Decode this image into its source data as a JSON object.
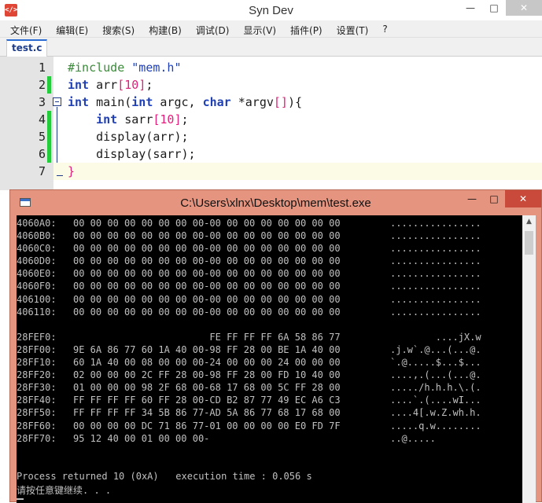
{
  "window": {
    "title": "Syn Dev",
    "minimize": "—",
    "maximize": "□",
    "close": "✕"
  },
  "menu": [
    "文件(F)",
    "编辑(E)",
    "搜索(S)",
    "构建(B)",
    "调试(D)",
    "显示(V)",
    "插件(P)",
    "设置(T)",
    "?"
  ],
  "tab": {
    "label": "test.c"
  },
  "editor": {
    "line_numbers": [
      "1",
      "2",
      "3",
      "4",
      "5",
      "6",
      "7"
    ],
    "line1": {
      "pre": "#include ",
      "str": "\"mem.h\""
    },
    "line2": {
      "kw": "int",
      "t1": " arr",
      "b1": "[",
      "n1": "10",
      "b2": "]",
      "t2": ";"
    },
    "line3": {
      "kw1": "int",
      "t1": " main(",
      "kw2": "int",
      "t2": " argc, ",
      "kw3": "char",
      "t3": " *argv",
      "b1": "[]",
      "t4": "){"
    },
    "line4": {
      "indent": "    ",
      "kw": "int",
      "t1": " sarr",
      "b1": "[",
      "n1": "10",
      "b2": "]",
      "t2": ";"
    },
    "line5": {
      "code": "    display(arr);"
    },
    "line6": {
      "code": "    display(sarr);"
    },
    "line7": {
      "code": "}"
    }
  },
  "console": {
    "title": "C:\\Users\\xlnx\\Desktop\\mem\\test.exe",
    "minimize": "—",
    "maximize": "□",
    "close": "✕",
    "block1": [
      {
        "addr": "4060A0:",
        "hex": "00 00 00 00 00 00 00 00-00 00 00 00 00 00 00 00",
        "ascii": "................"
      },
      {
        "addr": "4060B0:",
        "hex": "00 00 00 00 00 00 00 00-00 00 00 00 00 00 00 00",
        "ascii": "................"
      },
      {
        "addr": "4060C0:",
        "hex": "00 00 00 00 00 00 00 00-00 00 00 00 00 00 00 00",
        "ascii": "................"
      },
      {
        "addr": "4060D0:",
        "hex": "00 00 00 00 00 00 00 00-00 00 00 00 00 00 00 00",
        "ascii": "................"
      },
      {
        "addr": "4060E0:",
        "hex": "00 00 00 00 00 00 00 00-00 00 00 00 00 00 00 00",
        "ascii": "................"
      },
      {
        "addr": "4060F0:",
        "hex": "00 00 00 00 00 00 00 00-00 00 00 00 00 00 00 00",
        "ascii": "................"
      },
      {
        "addr": "406100:",
        "hex": "00 00 00 00 00 00 00 00-00 00 00 00 00 00 00 00",
        "ascii": "................"
      },
      {
        "addr": "406110:",
        "hex": "00 00 00 00 00 00 00 00-00 00 00 00 00 00 00 00",
        "ascii": "................"
      }
    ],
    "block2": [
      {
        "addr": "28FEF0:",
        "hex": "                        FE FF FF FF 6A 58 86 77",
        "ascii": "        ....jX.w"
      },
      {
        "addr": "28FF00:",
        "hex": "9E 6A 86 77 60 1A 40 00-98 FF 28 00 BE 1A 40 00",
        "ascii": ".j.w`.@...(...@."
      },
      {
        "addr": "28FF10:",
        "hex": "60 1A 40 00 08 00 00 00-24 00 00 00 24 00 00 00",
        "ascii": "`.@.....$...$..."
      },
      {
        "addr": "28FF20:",
        "hex": "02 00 00 00 2C FF 28 00-98 FF 28 00 FD 10 40 00",
        "ascii": "....,.(...(...@."
      },
      {
        "addr": "28FF30:",
        "hex": "01 00 00 00 98 2F 68 00-68 17 68 00 5C FF 28 00",
        "ascii": "...../h.h.h.\\.(."
      },
      {
        "addr": "28FF40:",
        "hex": "FF FF FF FF 60 FF 28 00-CD B2 87 77 49 EC A6 C3",
        "ascii": "....`.(....wI..."
      },
      {
        "addr": "28FF50:",
        "hex": "FF FF FF FF 34 5B 86 77-AD 5A 86 77 68 17 68 00",
        "ascii": "....4[.w.Z.wh.h."
      },
      {
        "addr": "28FF60:",
        "hex": "00 00 00 00 DC 71 86 77-01 00 00 00 00 E0 FD 7F",
        "ascii": ".....q.w........"
      },
      {
        "addr": "28FF70:",
        "hex": "95 12 40 00 01 00 00 00-",
        "ascii": "..@....."
      }
    ],
    "status": "Process returned 10 (0xA)   execution time : 0.056 s",
    "prompt": "请按任意键继续. . ."
  }
}
